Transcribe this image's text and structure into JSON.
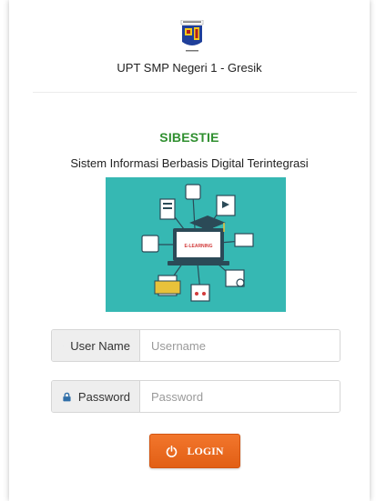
{
  "school": {
    "name": "UPT SMP Negeri 1 - Gresik"
  },
  "app": {
    "title": "SIBESTIE",
    "subtitle": "Sistem Informasi Berbasis Digital Terintegrasi",
    "illustration_text": "E-LEARNING"
  },
  "form": {
    "username": {
      "label": "User Name",
      "placeholder": "Username",
      "value": ""
    },
    "password": {
      "label": "Password",
      "placeholder": "Password",
      "value": ""
    },
    "login_label": "LOGIN"
  },
  "icons": {
    "user": "user-icon",
    "lock": "lock-icon",
    "power": "power-icon"
  },
  "colors": {
    "title": "#2f8f2f",
    "button": "#ee6a22",
    "illustration_bg": "#36b8b3",
    "addon_bg": "#eeeeee"
  }
}
